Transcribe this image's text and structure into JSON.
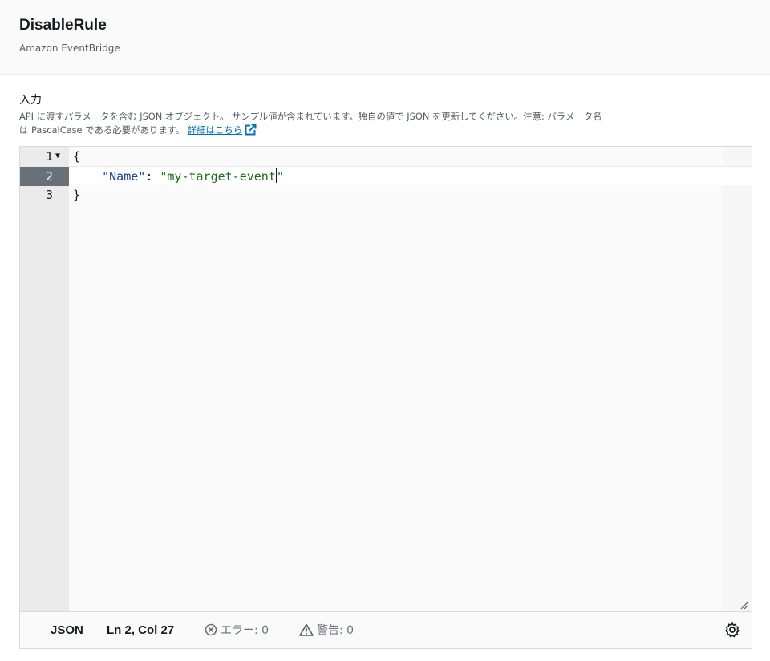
{
  "header": {
    "title": "DisableRule",
    "subtitle": "Amazon EventBridge"
  },
  "input": {
    "label": "入力",
    "description_line1": "API に渡すパラメータを含む JSON オブジェクト。 サンプル値が含まれています。独自の値で JSON を更新してください。注意: パラメータ名",
    "description_line2": "は PascalCase である必要があります。",
    "learn_more_link": "詳細はこちら",
    "external_icon": "external-link-icon"
  },
  "editor": {
    "lines": [
      {
        "number": "1",
        "code": "{"
      },
      {
        "number": "2",
        "key": "\"Name\"",
        "sep": ": ",
        "value": "\"my-target-event"
      },
      {
        "number": "3",
        "code": "}"
      }
    ],
    "value_tail": "\"",
    "fold_icon": "fold-triangle-icon"
  },
  "statusbar": {
    "mode": "JSON",
    "position": "Ln 2, Col 27",
    "errors": "エラー: 0",
    "warnings": "警告: 0",
    "settings_icon": "gear-icon"
  },
  "colors": {
    "link": "#0073bb",
    "key_token": "#1d3d8f",
    "string_token": "#1e6b1e",
    "active_gutter": "#687078"
  }
}
